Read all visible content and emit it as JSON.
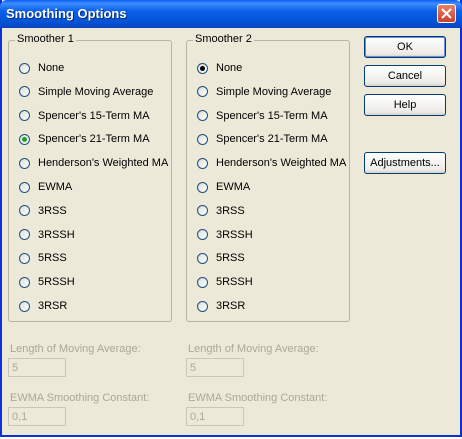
{
  "window": {
    "title": "Smoothing Options"
  },
  "smoother1": {
    "title": "Smoother 1",
    "options": [
      "None",
      "Simple Moving Average",
      "Spencer's 15-Term MA",
      "Spencer's 21-Term MA",
      "Henderson's Weighted MA",
      "EWMA",
      "3RSS",
      "3RSSH",
      "5RSS",
      "5RSSH",
      "3RSR"
    ],
    "selected": "Spencer's 21-Term MA"
  },
  "smoother2": {
    "title": "Smoother 2",
    "options": [
      "None",
      "Simple Moving Average",
      "Spencer's 15-Term MA",
      "Spencer's 21-Term MA",
      "Henderson's Weighted MA",
      "EWMA",
      "3RSS",
      "3RSSH",
      "5RSS",
      "5RSSH",
      "3RSR"
    ],
    "selected": "None"
  },
  "buttons": {
    "ok": "OK",
    "cancel": "Cancel",
    "help": "Help",
    "adjustments": "Adjustments..."
  },
  "left_params": {
    "length_label": "Length of Moving Average:",
    "length_value": "5",
    "ewma_label": "EWMA Smoothing Constant:",
    "ewma_value": "0,1"
  },
  "right_params": {
    "length_label": "Length of Moving Average:",
    "length_value": "5",
    "ewma_label": "EWMA Smoothing Constant:",
    "ewma_value": "0,1"
  },
  "colors": {
    "titlebar": "#0A5CF5",
    "dialog_bg": "#ECE9D8",
    "radio_selected": "#21A121"
  }
}
